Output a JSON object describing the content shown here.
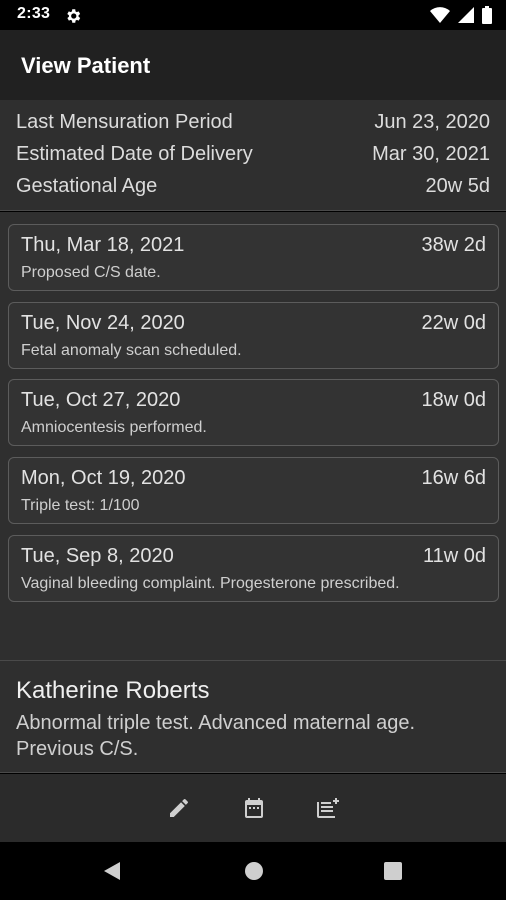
{
  "status_bar": {
    "time": "2:33",
    "icons": [
      "settings-gear-icon",
      "wifi-icon",
      "cellular-signal-icon",
      "battery-icon"
    ]
  },
  "app_bar": {
    "title": "View Patient"
  },
  "summary": {
    "rows": [
      {
        "label": "Last Mensuration Period",
        "value": "Jun 23, 2020"
      },
      {
        "label": "Estimated Date of Delivery",
        "value": "Mar 30, 2021"
      },
      {
        "label": "Gestational Age",
        "value": "20w 5d"
      }
    ]
  },
  "events": [
    {
      "date": "Thu, Mar 18, 2021",
      "age": "38w 2d",
      "note": "Proposed C/S date."
    },
    {
      "date": "Tue, Nov 24, 2020",
      "age": "22w 0d",
      "note": "Fetal anomaly scan scheduled."
    },
    {
      "date": "Tue, Oct 27, 2020",
      "age": "18w 0d",
      "note": "Amniocentesis performed."
    },
    {
      "date": "Mon, Oct 19, 2020",
      "age": "16w 6d",
      "note": "Triple test: 1/100"
    },
    {
      "date": "Tue, Sep 8, 2020",
      "age": "11w 0d",
      "note": "Vaginal bleeding complaint. Progesterone prescribed."
    }
  ],
  "patient": {
    "name": "Katherine Roberts",
    "description": "Abnormal triple test. Advanced maternal age. Previous C/S."
  },
  "bottom_actions": [
    "edit-icon",
    "calendar-icon",
    "add-note-icon"
  ],
  "colors": {
    "background": "#2f2f2f",
    "app_bar": "#212121",
    "card_border": "#5c5c5c",
    "icon": "#cfcfcf"
  }
}
